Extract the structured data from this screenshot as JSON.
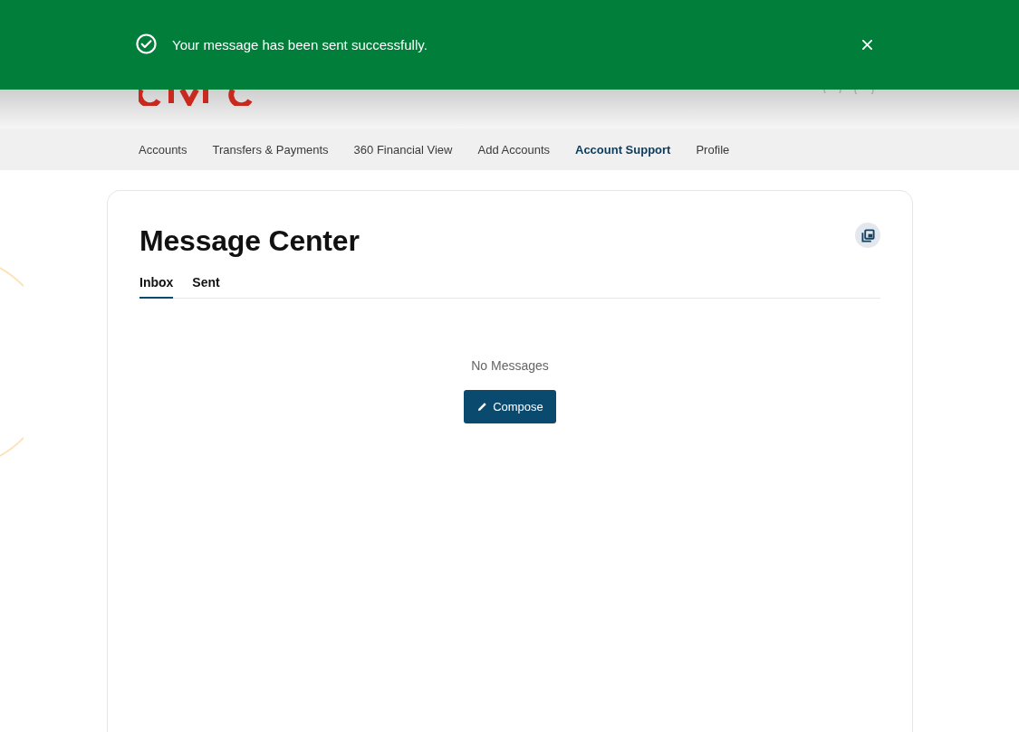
{
  "banner": {
    "message": "Your message has been sent successfully."
  },
  "nav": {
    "items": [
      {
        "label": "Accounts",
        "selected": false
      },
      {
        "label": "Transfers & Payments",
        "selected": false
      },
      {
        "label": "360 Financial View",
        "selected": false
      },
      {
        "label": "Add Accounts",
        "selected": false
      },
      {
        "label": "Account Support",
        "selected": true
      },
      {
        "label": "Profile",
        "selected": false
      }
    ]
  },
  "message_center": {
    "title": "Message Center",
    "tabs": [
      {
        "label": "Inbox",
        "selected": true
      },
      {
        "label": "Sent",
        "selected": false
      }
    ],
    "empty_text": "No Messages",
    "compose_button": "Compose"
  }
}
